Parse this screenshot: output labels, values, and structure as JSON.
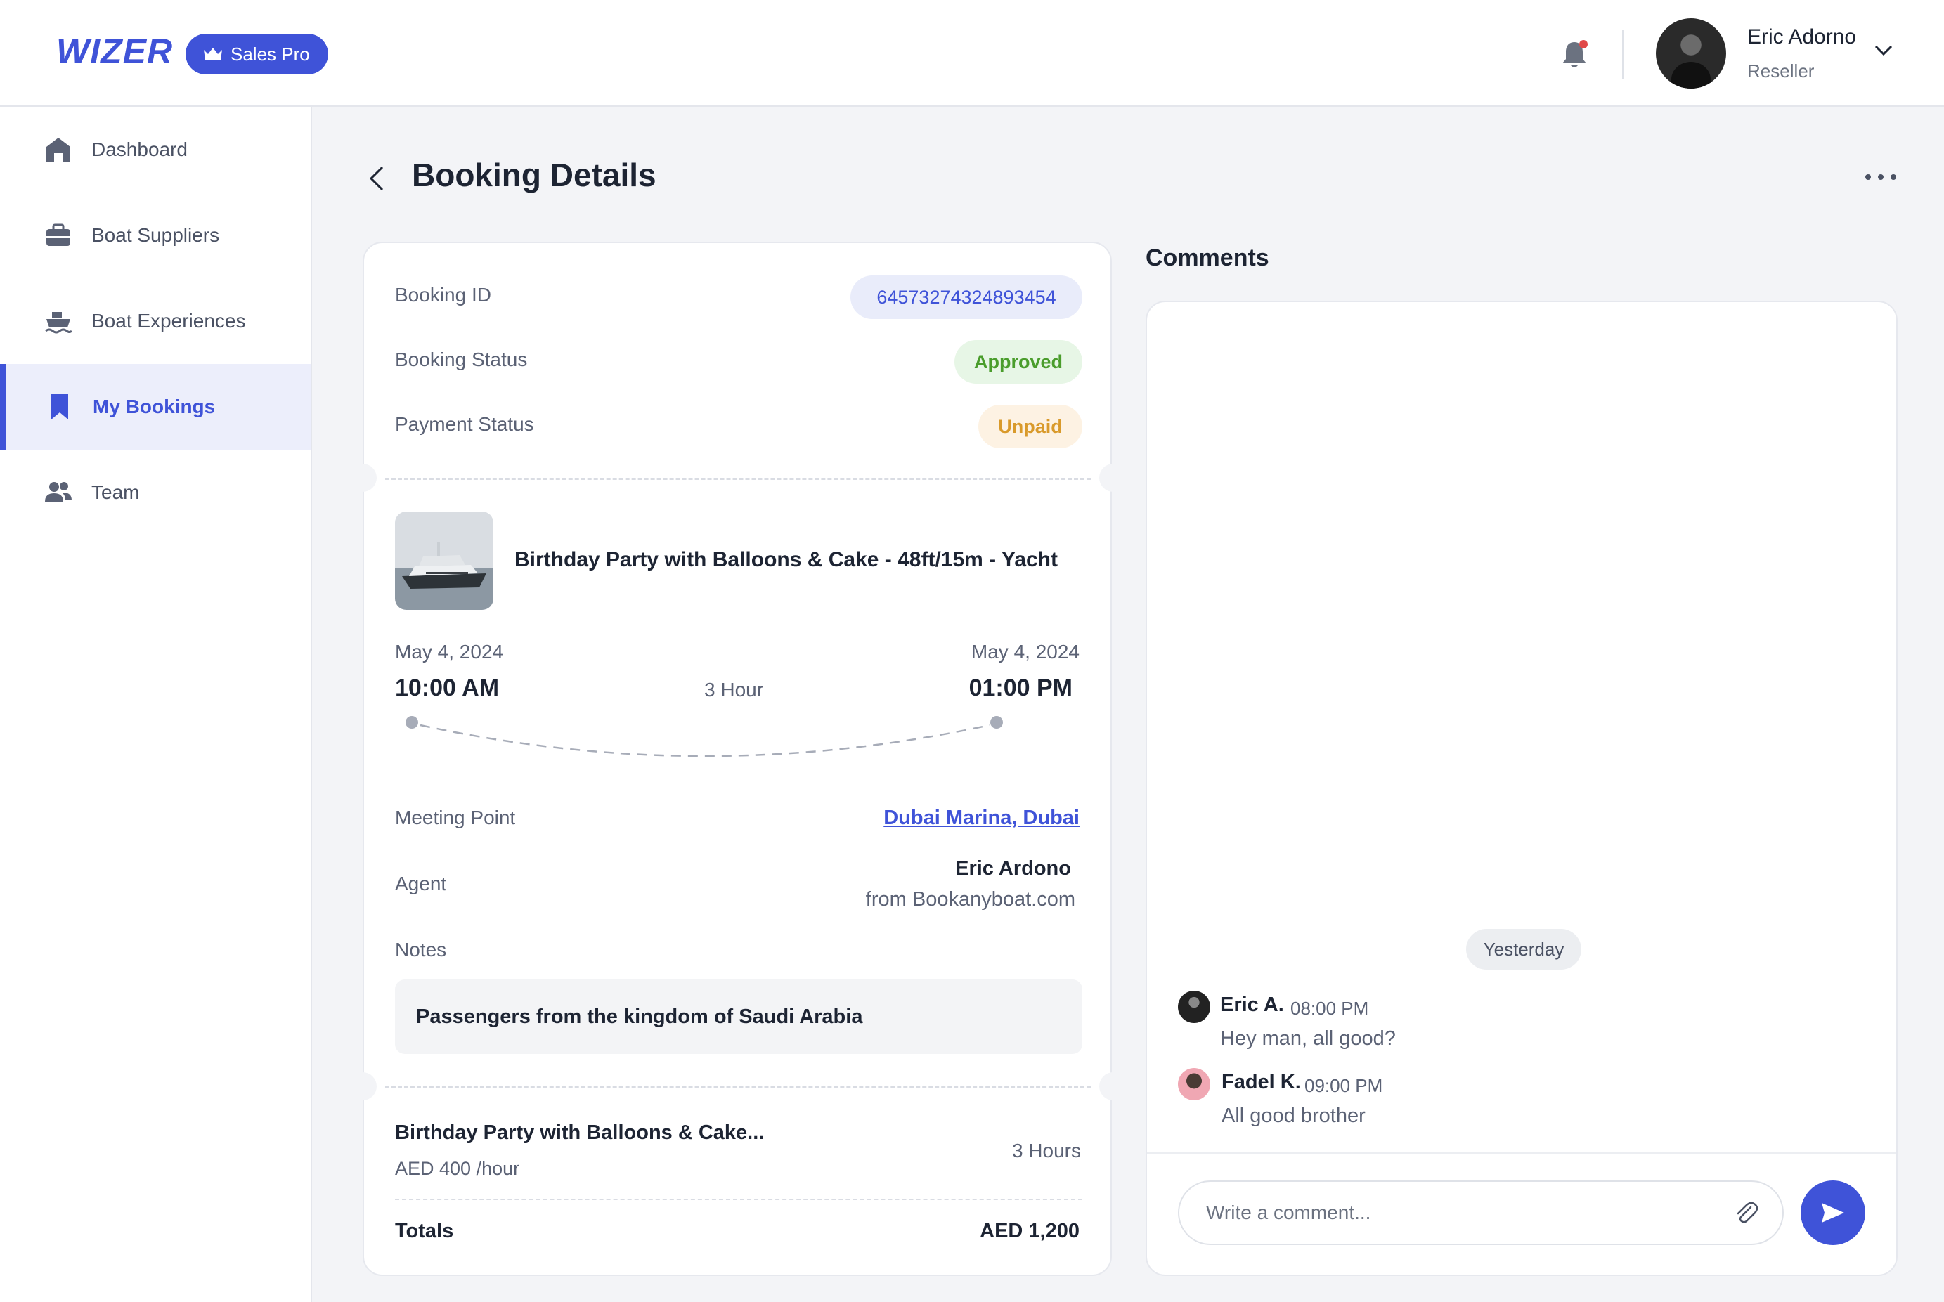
{
  "header": {
    "logo": "WIZER",
    "plan_badge": "Sales Pro",
    "user": {
      "name": "Eric Adorno",
      "role": "Reseller"
    }
  },
  "sidebar": {
    "items": [
      {
        "label": "Dashboard",
        "icon": "home-icon",
        "active": false
      },
      {
        "label": "Boat Suppliers",
        "icon": "briefcase-icon",
        "active": false
      },
      {
        "label": "Boat Experiences",
        "icon": "ship-icon",
        "active": false
      },
      {
        "label": "My Bookings",
        "icon": "bookmark-icon",
        "active": true
      },
      {
        "label": "Team",
        "icon": "users-icon",
        "active": false
      }
    ]
  },
  "page": {
    "title": "Booking Details"
  },
  "booking": {
    "id_label": "Booking ID",
    "id_value": "64573274324893454",
    "status_label": "Booking Status",
    "status_value": "Approved",
    "payment_label": "Payment Status",
    "payment_value": "Unpaid",
    "experience_title": "Birthday Party with Balloons & Cake - 48ft/15m - Yacht",
    "start_date": "May 4, 2024",
    "start_time": "10:00 AM",
    "end_date": "May 4, 2024",
    "end_time": "01:00 PM",
    "duration": "3 Hour",
    "meeting_label": "Meeting Point",
    "meeting_value": "Dubai Marina, Dubai",
    "agent_label": "Agent",
    "agent_name": "Eric Ardono",
    "agent_from": "from Bookanyboat.com",
    "notes_label": "Notes",
    "notes_value": "Passengers from the kingdom of Saudi Arabia",
    "summary_title": "Birthday Party with Balloons & Cake...",
    "summary_rate": "AED 400 /hour",
    "summary_hours": "3 Hours",
    "totals_label": "Totals",
    "totals_value": "AED 1,200"
  },
  "comments": {
    "title": "Comments",
    "day_chip": "Yesterday",
    "messages": [
      {
        "author": "Eric A.",
        "time": "08:00 PM",
        "text": "Hey man, all good?"
      },
      {
        "author": "Fadel K.",
        "time": "09:00 PM",
        "text": "All good brother"
      }
    ],
    "input_placeholder": "Write a comment..."
  },
  "colors": {
    "accent": "#3f53d8",
    "approved": "#4a9d2c",
    "unpaid": "#d99a2b",
    "notification_dot": "#e04848"
  }
}
